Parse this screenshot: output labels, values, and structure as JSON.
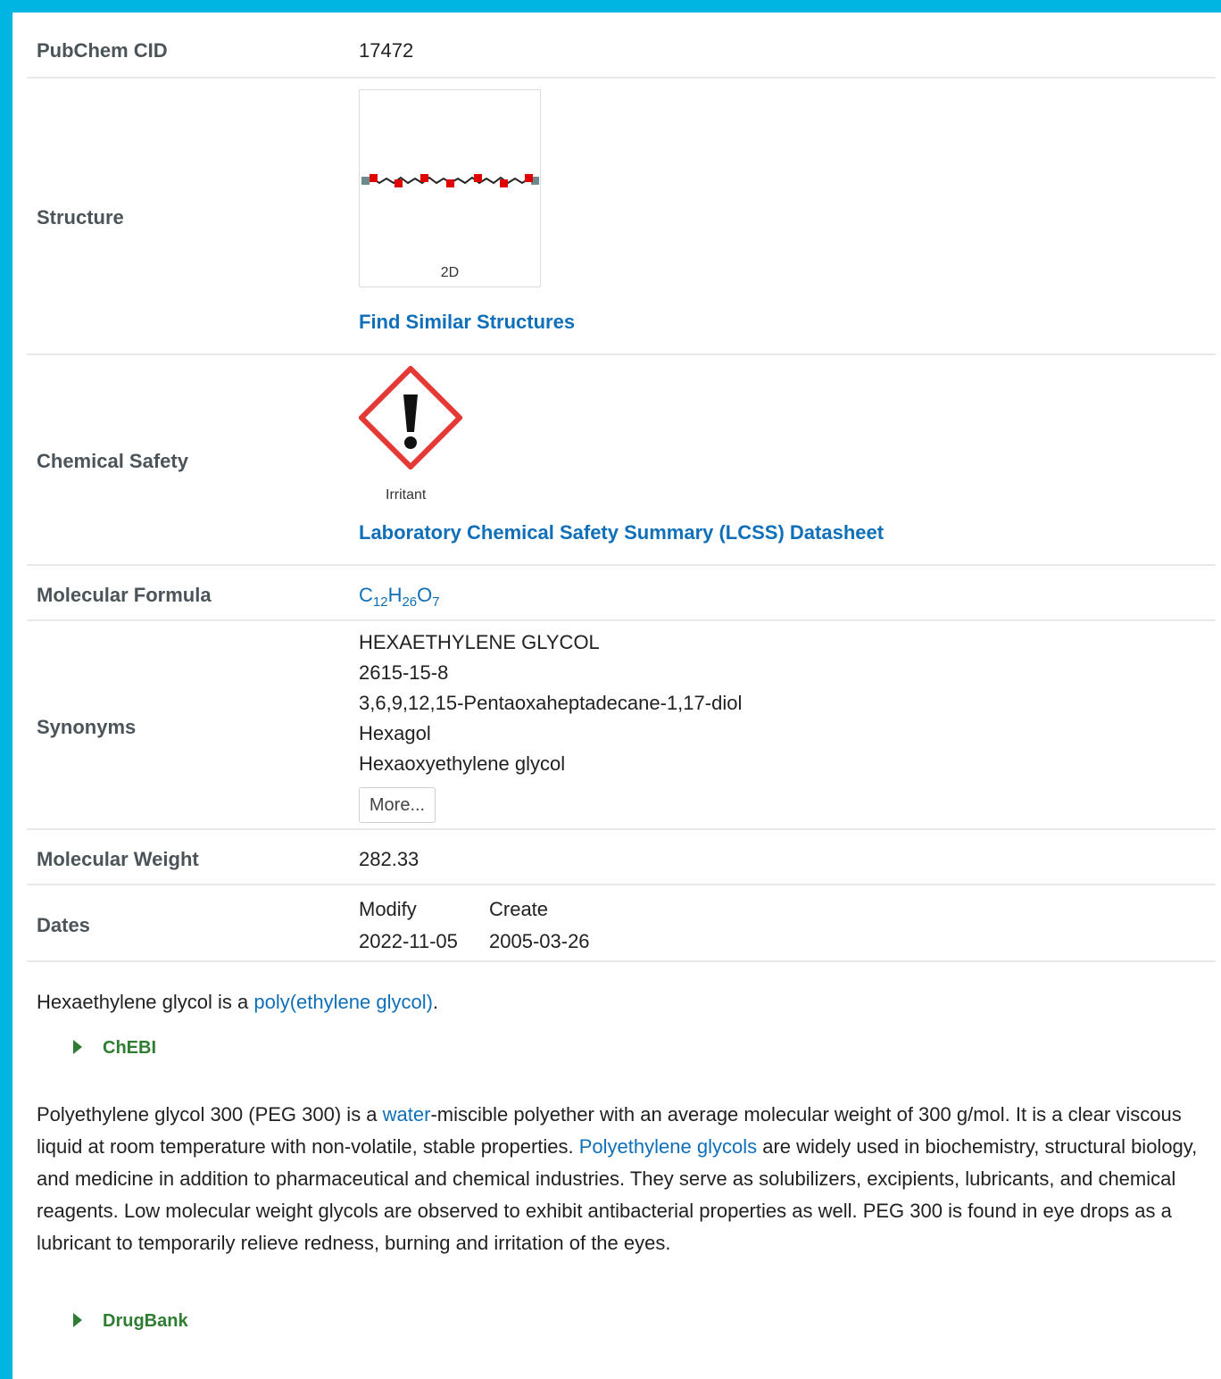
{
  "rows": {
    "cid": {
      "label": "PubChem CID",
      "value": "17472"
    },
    "structure": {
      "label": "Structure",
      "caption": "2D",
      "link": "Find Similar Structures"
    },
    "safety": {
      "label": "Chemical Safety",
      "pictogram_caption": "Irritant",
      "link": "Laboratory Chemical Safety Summary (LCSS) Datasheet"
    },
    "formula": {
      "label": "Molecular Formula",
      "c": "C",
      "c_n": "12",
      "h": "H",
      "h_n": "26",
      "o": "O",
      "o_n": "7"
    },
    "synonyms": {
      "label": "Synonyms",
      "items": [
        "HEXAETHYLENE GLYCOL",
        "2615-15-8",
        "3,6,9,12,15-Pentaoxaheptadecane-1,17-diol",
        "Hexagol",
        "Hexaoxyethylene glycol"
      ],
      "more_button": "More..."
    },
    "weight": {
      "label": "Molecular Weight",
      "value": "282.33"
    },
    "dates": {
      "label": "Dates",
      "modify_label": "Modify",
      "create_label": "Create",
      "modify": "2022-11-05",
      "create": "2005-03-26"
    }
  },
  "description1": {
    "before": "Hexaethylene glycol is a ",
    "link": "poly(ethylene glycol)",
    "after": ".",
    "source": "ChEBI"
  },
  "description2": {
    "p1": "Polyethylene glycol 300 (PEG 300) is a ",
    "link1": "water",
    "p2": "-miscible polyether with an average molecular weight of 300 g/mol. It is a clear viscous liquid at room temperature with non-volatile, stable properties. ",
    "link2": "Polyethylene glycols",
    "p3": " are widely used in biochemistry, structural biology, and medicine in addition to pharmaceutical and chemical industries. They serve as solubilizers, excipients, lubricants, and chemical reagents. Low molecular weight glycols are observed to exhibit antibacterial properties as well. PEG 300 is found in eye drops as a lubricant to temporarily relieve redness, burning and irritation of the eyes.",
    "source": "DrugBank"
  },
  "colors": {
    "frame": "#00b5e2",
    "link": "#0f6fb8",
    "source": "#2e7d32",
    "hazard": "#e53935"
  },
  "icons": {
    "hazard": "exclamation-mark-pictogram-icon",
    "expand": "triangle-right-icon"
  }
}
